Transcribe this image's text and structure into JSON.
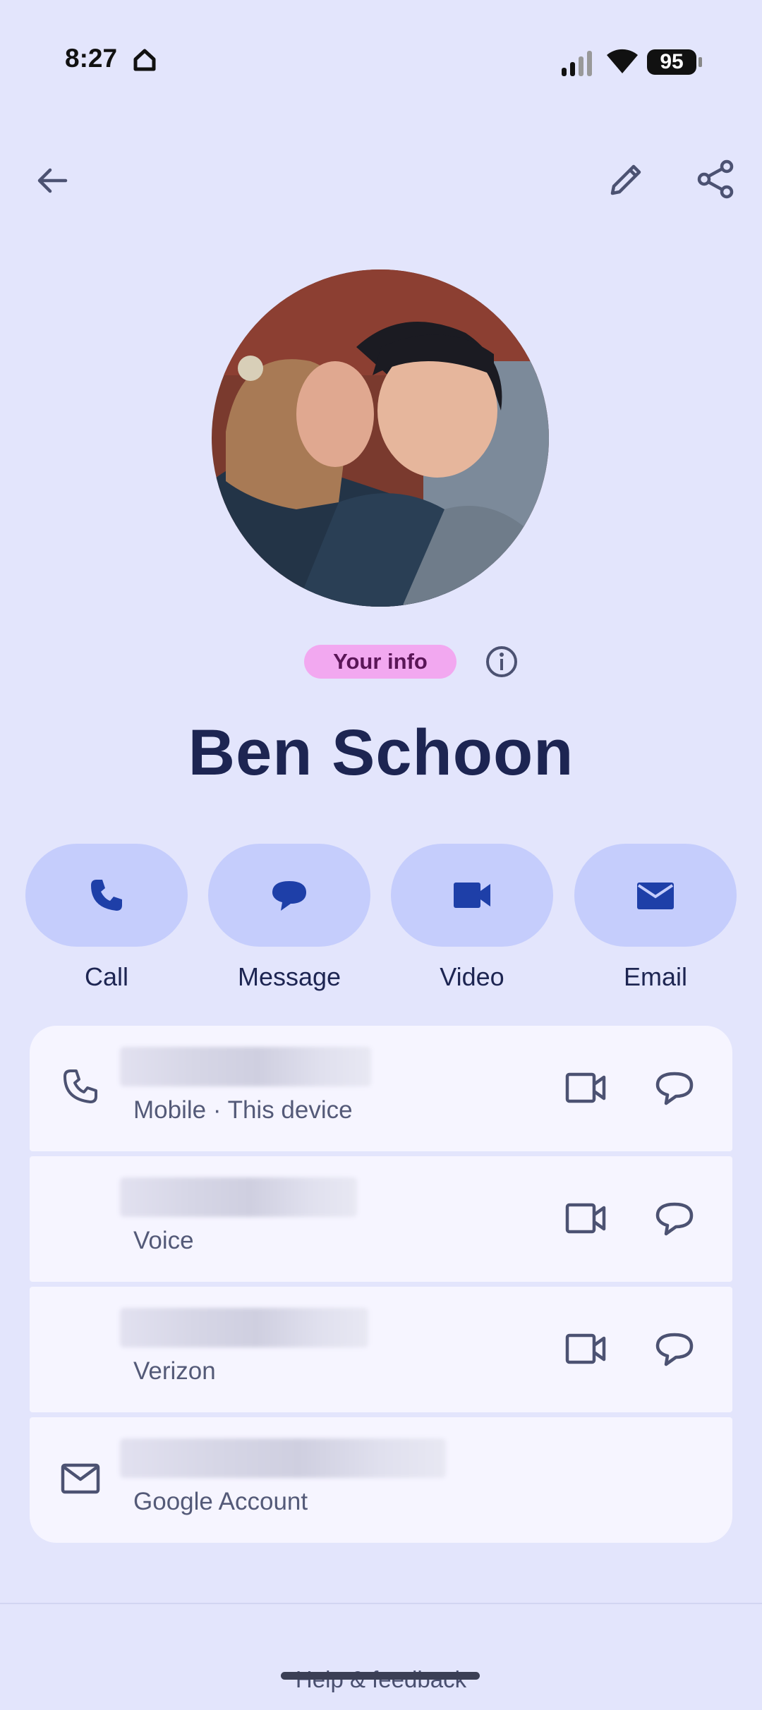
{
  "status_bar": {
    "time": "8:27",
    "battery": "95"
  },
  "header": {
    "back_icon": "arrow-back-icon",
    "edit_icon": "pencil-icon",
    "share_icon": "share-icon"
  },
  "profile": {
    "badge": "Your info",
    "name": "Ben Schoon"
  },
  "actions": [
    {
      "label": "Call",
      "icon": "phone-icon"
    },
    {
      "label": "Message",
      "icon": "message-icon"
    },
    {
      "label": "Video",
      "icon": "video-icon"
    },
    {
      "label": "Email",
      "icon": "email-icon"
    }
  ],
  "contact_rows": [
    {
      "sublabel": "Mobile · This device",
      "icon": "phone-icon"
    },
    {
      "sublabel": "Voice"
    },
    {
      "sublabel": "Verizon"
    },
    {
      "sublabel": "Google Account",
      "icon": "email-icon"
    }
  ],
  "footer": {
    "help": "Help & feedback"
  },
  "colors": {
    "background": "#e3e5fc",
    "action_pill": "#c5cdfc",
    "action_icon": "#1e3fa8",
    "badge": "#f2a8f0",
    "card": "#f6f5ff"
  }
}
